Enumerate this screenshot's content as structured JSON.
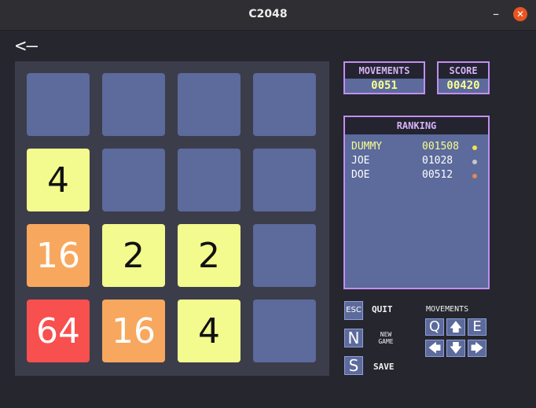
{
  "window": {
    "title": "C2048",
    "minimize_glyph": "–",
    "close_glyph": "✕"
  },
  "back": {
    "label": "<–",
    "icon": "back-arrow-icon"
  },
  "board": {
    "rows": [
      [
        null,
        null,
        null,
        null
      ],
      [
        "4",
        null,
        null,
        null
      ],
      [
        "16",
        "2",
        "2",
        null
      ],
      [
        "64",
        "16",
        "4",
        null
      ]
    ]
  },
  "colors": {
    "empty": "#5c6a9c",
    "tile_2": "#f3fa8e",
    "tile_4": "#f3fa8e",
    "tile_16": "#f8a75e",
    "tile_64": "#f84f4f",
    "accent": "#c28ef2",
    "highlight": "#f7ff8f"
  },
  "movements": {
    "label": "MOVEMENTS",
    "value": "0051"
  },
  "score": {
    "label": "SCORE",
    "value": "00420"
  },
  "ranking": {
    "title": "RANKING",
    "entries": [
      {
        "name": "DUMMY",
        "score": "001508",
        "dot_color": "#f5e14a",
        "color": "#f7ff8f"
      },
      {
        "name": "JOE",
        "score": "01028",
        "dot_color": "#c8c8c8",
        "color": "#ffffff"
      },
      {
        "name": "DOE",
        "score": "00512",
        "dot_color": "#e08a4a",
        "color": "#ffffff"
      }
    ]
  },
  "controls": {
    "esc_key": "ESC",
    "quit_label": "QUIT",
    "n_key": "N",
    "new_game_line1": "NEW",
    "new_game_line2": "GAME",
    "s_key": "S",
    "save_label": "SAVE",
    "movements_label": "MOVEMENTS",
    "q_key": "Q",
    "up_key": "🡅",
    "e_key": "E",
    "left_key": "🡄",
    "down_key": "🡇",
    "right_key": "🡆"
  }
}
